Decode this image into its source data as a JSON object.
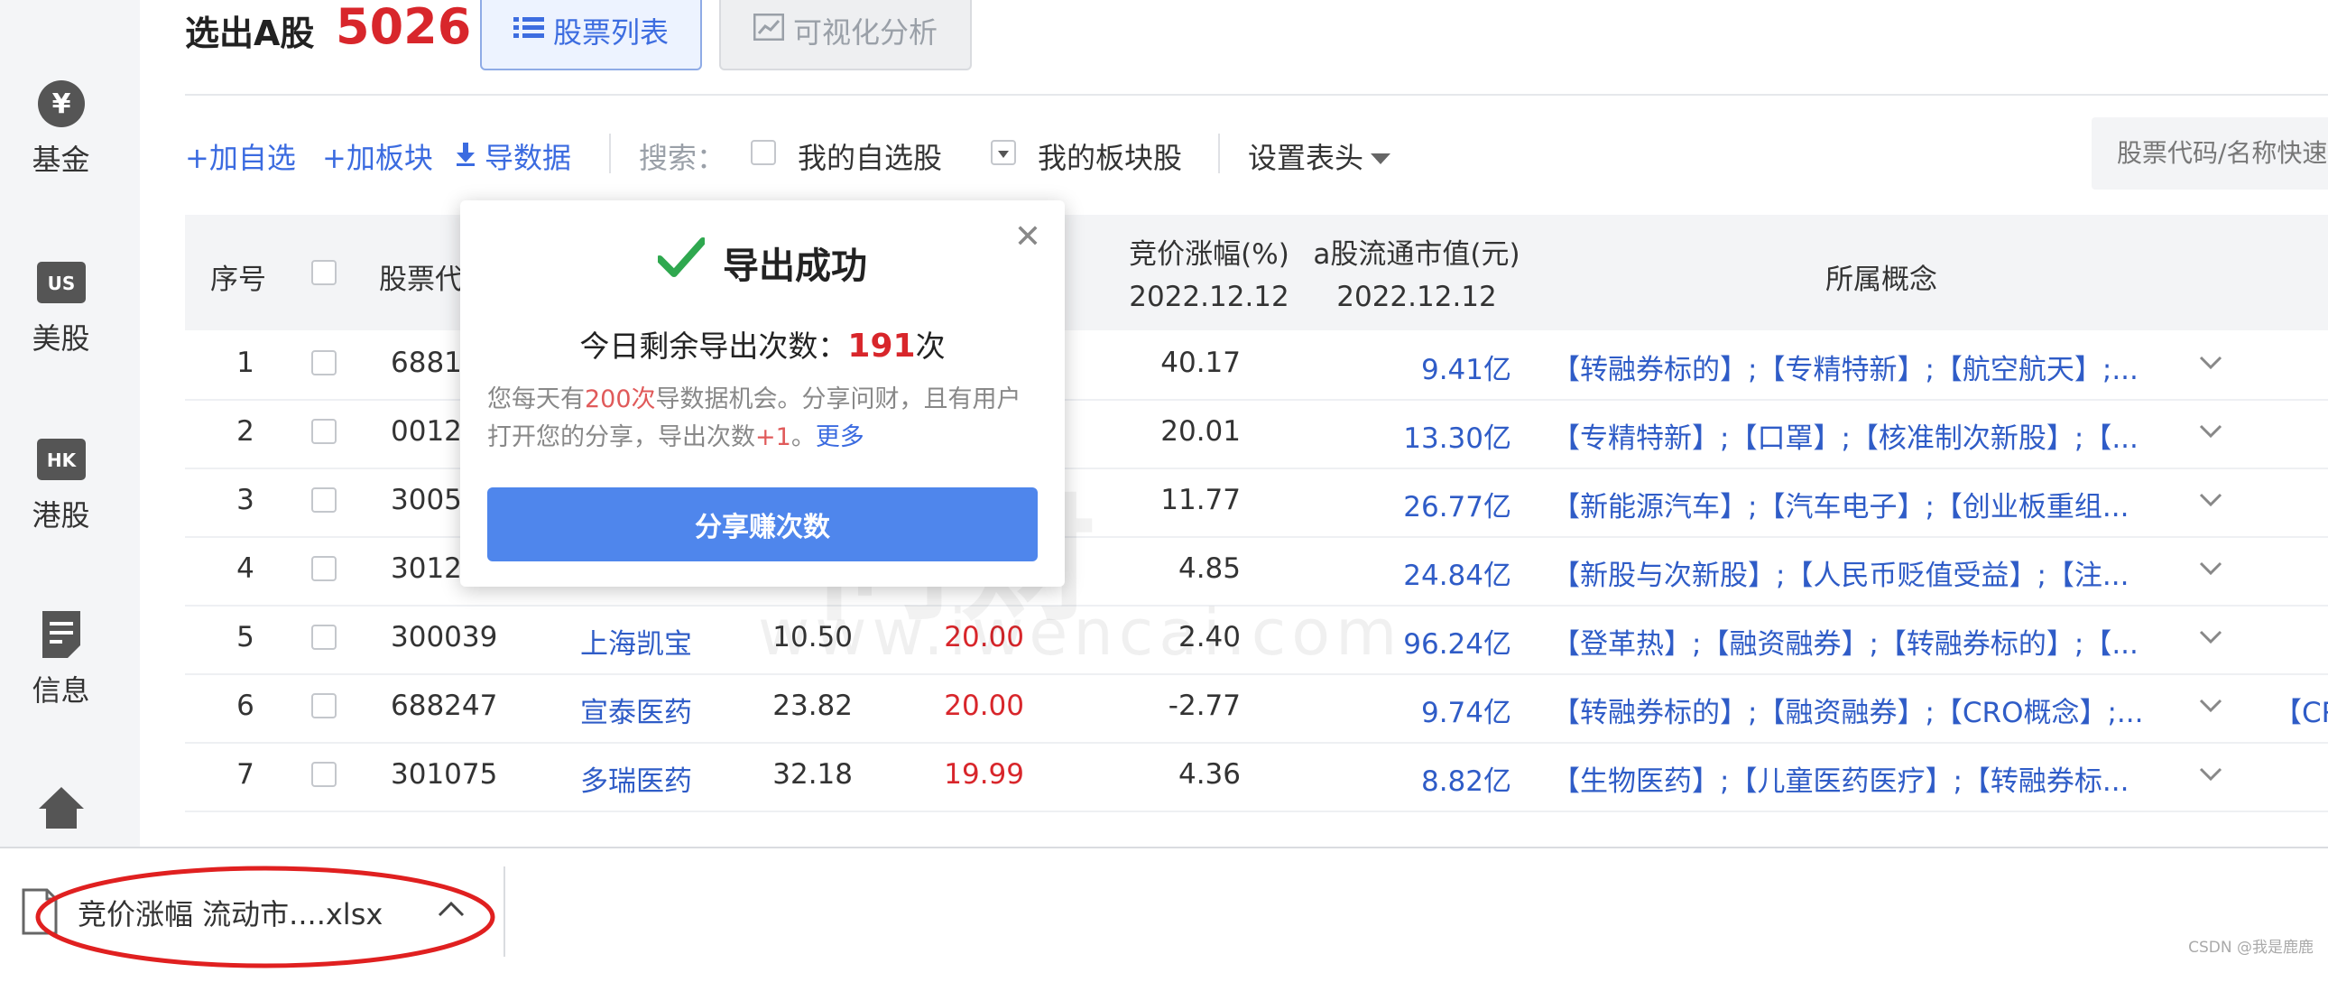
{
  "sidebar": {
    "items": [
      {
        "label": "基金",
        "icon": "yen-icon"
      },
      {
        "label": "美股",
        "icon": "us-badge-icon",
        "badge": "US"
      },
      {
        "label": "港股",
        "icon": "hk-badge-icon",
        "badge": "HK"
      },
      {
        "label": "信息",
        "icon": "document-icon"
      }
    ]
  },
  "header": {
    "title": "选出A股",
    "count": "5026",
    "tabs": [
      {
        "label": "股票列表",
        "active": true
      },
      {
        "label": "可视化分析",
        "active": false
      }
    ]
  },
  "toolbar": {
    "add_watch": "+加自选",
    "add_sector": "+加板块",
    "export": "导数据",
    "search_label": "搜索：",
    "my_watch": "我的自选股",
    "my_sector": "我的板块股",
    "set_header": "设置表头",
    "search_placeholder": "股票代码/名称快速"
  },
  "table": {
    "headers": {
      "idx": "序号",
      "code": "股票代",
      "auction": "竞价涨幅(%)",
      "auction_date": "2022.12.12",
      "cap": "a股流通市值(元)",
      "cap_date": "2022.12.12",
      "concept": "所属概念"
    },
    "rows": [
      {
        "idx": "1",
        "code": "6881",
        "name": "",
        "price": "",
        "chg": "",
        "auction": "40.17",
        "cap": "9.41亿",
        "concept": "【转融券标的】;【专精特新】;【航空航天】;...",
        "extra": ""
      },
      {
        "idx": "2",
        "code": "0012",
        "name": "",
        "price": "",
        "chg": "",
        "auction": "20.01",
        "cap": "13.30亿",
        "concept": "【专精特新】;【口罩】;【核准制次新股】;【...",
        "extra": ""
      },
      {
        "idx": "3",
        "code": "3005",
        "name": "",
        "price": "",
        "chg": "",
        "auction": "11.77",
        "cap": "26.77亿",
        "concept": "【新能源汽车】;【汽车电子】;【创业板重组...",
        "extra": ""
      },
      {
        "idx": "4",
        "code": "3012",
        "name": "",
        "price": "",
        "chg": "",
        "auction": "4.85",
        "cap": "24.84亿",
        "concept": "【新股与次新股】;【人民币贬值受益】;【注...",
        "extra": ""
      },
      {
        "idx": "5",
        "code": "300039",
        "name": "上海凯宝",
        "price": "10.50",
        "chg": "20.00",
        "auction": "2.40",
        "cap": "96.24亿",
        "concept": "【登革热】;【融资融券】;【转融券标的】;【...",
        "extra": ""
      },
      {
        "idx": "6",
        "code": "688247",
        "name": "宣泰医药",
        "price": "23.82",
        "chg": "20.00",
        "auction": "-2.77",
        "cap": "9.74亿",
        "concept": "【转融券标的】;【融资融券】;【CRO概念】;...",
        "extra": "【CR"
      },
      {
        "idx": "7",
        "code": "301075",
        "name": "多瑞医药",
        "price": "32.18",
        "chg": "19.99",
        "auction": "4.36",
        "cap": "8.82亿",
        "concept": "【生物医药】;【儿童医药医疗】;【转融券标...",
        "extra": ""
      }
    ]
  },
  "watermark": {
    "line1": "问财",
    "line2": "www.iwencai.com"
  },
  "popup": {
    "title": "导出成功",
    "remain_prefix": "今日剩余导出次数：",
    "remain_count": "191",
    "remain_suffix": "次",
    "desc_a": "您每天有",
    "desc_count": "200次",
    "desc_b": "导数据机会。分享问财，且有用户打开您的分享，导出次数",
    "desc_plus": "+1",
    "desc_c": "。",
    "more": "更多",
    "share_button": "分享赚次数"
  },
  "download": {
    "filename": "竞价涨幅 流动市....xlsx"
  },
  "footer": {
    "credit": "CSDN @我是鹿鹿"
  },
  "colors": {
    "accent": "#3b6be0",
    "red": "#d8262b",
    "button": "#4f86ec",
    "annotation": "#e02020"
  }
}
